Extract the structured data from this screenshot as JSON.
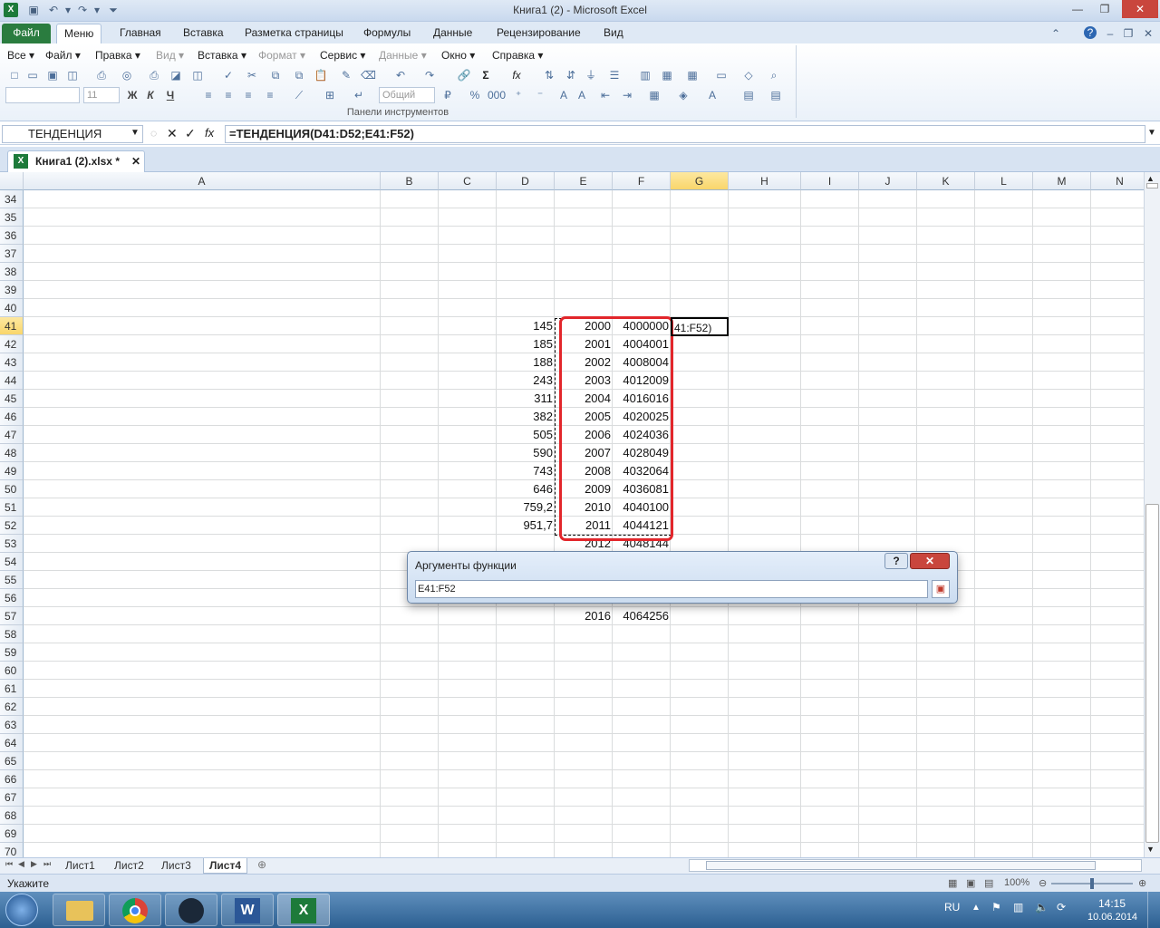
{
  "window": {
    "title": "Книга1 (2)  -  Microsoft Excel",
    "app_icon": "excel-icon"
  },
  "ribbon_tabs": [
    "Файл",
    "Меню",
    "Главная",
    "Вставка",
    "Разметка страницы",
    "Формулы",
    "Данные",
    "Рецензирование",
    "Вид"
  ],
  "menu_bar": {
    "items": [
      {
        "label": "Все",
        "enabled": true
      },
      {
        "label": "Файл",
        "enabled": true
      },
      {
        "label": "Правка",
        "enabled": true
      },
      {
        "label": "Вид",
        "enabled": false
      },
      {
        "label": "Вставка",
        "enabled": true
      },
      {
        "label": "Формат",
        "enabled": false
      },
      {
        "label": "Сервис",
        "enabled": true
      },
      {
        "label": "Данные",
        "enabled": false
      },
      {
        "label": "Окно",
        "enabled": true
      },
      {
        "label": "Справка",
        "enabled": true
      }
    ]
  },
  "toolbar": {
    "font_size": "11",
    "number_format": "Общий",
    "zoom_combo_label": "",
    "bold": "Ж",
    "italic": "К",
    "underline": "Ч",
    "sum": "Σ",
    "fx": "fx",
    "group_label": "Панели инструментов"
  },
  "formula_bar": {
    "name_box": "ТЕНДЕНЦИЯ",
    "formula": "=ТЕНДЕНЦИЯ(D41:D52;E41:F52)"
  },
  "workbook_tab": {
    "name": "Книга1 (2).xlsx  *"
  },
  "columns": [
    "A",
    "B",
    "C",
    "D",
    "E",
    "F",
    "G",
    "H",
    "I",
    "J",
    "K",
    "L",
    "M",
    "N"
  ],
  "rows": [
    34,
    35,
    36,
    37,
    38,
    39,
    40,
    41,
    42,
    43,
    44,
    45,
    46,
    47,
    48,
    49,
    50,
    51,
    52,
    53,
    54,
    55,
    56,
    57,
    58,
    59,
    60,
    61,
    62,
    63,
    64,
    65,
    66,
    67,
    68,
    69,
    70
  ],
  "active_column": "G",
  "active_row": 41,
  "cells": {
    "D": [
      "145",
      "185",
      "188",
      "243",
      "311",
      "382",
      "505",
      "590",
      "743",
      "646",
      "759,2",
      "951,7"
    ],
    "E": [
      "2000",
      "2001",
      "2002",
      "2003",
      "2004",
      "2005",
      "2006",
      "2007",
      "2008",
      "2009",
      "2010",
      "2011",
      "2012"
    ],
    "F": [
      "4000000",
      "4004001",
      "4008004",
      "4012009",
      "4016016",
      "4020025",
      "4024036",
      "4028049",
      "4032064",
      "4036081",
      "4040100",
      "4044121",
      "4048144"
    ],
    "G41": "41:F52)",
    "E57": "2016",
    "F57": "4064256"
  },
  "dialog": {
    "title": "Аргументы функции",
    "input_value": "E41:F52",
    "help": "?",
    "close": "✕"
  },
  "sheets": [
    "Лист1",
    "Лист2",
    "Лист3",
    "Лист4"
  ],
  "active_sheet": "Лист4",
  "status": {
    "mode": "Укажите",
    "zoom": "100%"
  },
  "taskbar": {
    "lang": "RU",
    "time": "14:15",
    "date": "10.06.2014",
    "apps": [
      "explorer-icon",
      "chrome-icon",
      "steam-icon",
      "word-icon",
      "excel-icon"
    ]
  }
}
